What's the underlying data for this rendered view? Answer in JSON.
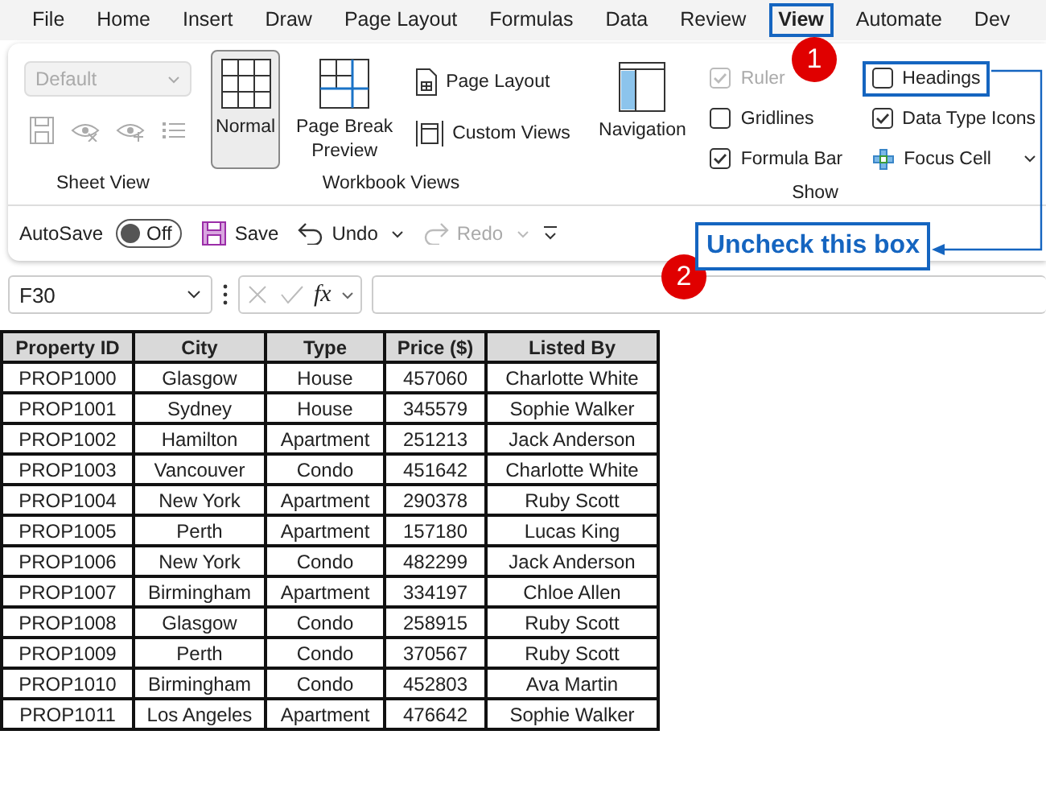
{
  "menu_tabs": [
    {
      "label": "File",
      "selected": false
    },
    {
      "label": "Home",
      "selected": false
    },
    {
      "label": "Insert",
      "selected": false
    },
    {
      "label": "Draw",
      "selected": false
    },
    {
      "label": "Page Layout",
      "selected": false
    },
    {
      "label": "Formulas",
      "selected": false
    },
    {
      "label": "Data",
      "selected": false
    },
    {
      "label": "Review",
      "selected": false
    },
    {
      "label": "View",
      "selected": true
    },
    {
      "label": "Automate",
      "selected": false
    },
    {
      "label": "Dev",
      "selected": false
    }
  ],
  "ribbon": {
    "sheet_view": {
      "label": "Sheet View",
      "dropdown": {
        "value": "Default",
        "disabled": true
      }
    },
    "workbook_views": {
      "label": "Workbook Views",
      "buttons": [
        {
          "kind": "large",
          "label": "Normal",
          "selected": true
        },
        {
          "kind": "large",
          "label": "Page Break Preview",
          "selected": false
        },
        {
          "kind": "small",
          "label": "Page Layout",
          "selected": false
        },
        {
          "kind": "small",
          "label": "Custom Views",
          "selected": false
        }
      ]
    },
    "show": {
      "label": "Show",
      "navigation": {
        "label": "Navigation"
      },
      "items": [
        {
          "kind": "checkbox",
          "label": "Ruler",
          "checked": true,
          "disabled": true,
          "highlighted": false
        },
        {
          "kind": "checkbox",
          "label": "Gridlines",
          "checked": false,
          "disabled": false,
          "highlighted": false
        },
        {
          "kind": "checkbox",
          "label": "Formula Bar",
          "checked": true,
          "disabled": false,
          "highlighted": false
        },
        {
          "kind": "checkbox",
          "label": "Headings",
          "checked": false,
          "disabled": false,
          "highlighted": true
        },
        {
          "kind": "checkbox",
          "label": "Data Type Icons",
          "checked": true,
          "disabled": false,
          "highlighted": false
        },
        {
          "kind": "button",
          "label": "Focus Cell"
        }
      ]
    }
  },
  "quick_access": {
    "autosave": {
      "label": "AutoSave",
      "on": false,
      "state_text": "Off"
    },
    "save": "Save",
    "undo": {
      "label": "Undo",
      "disabled": false
    },
    "redo": {
      "label": "Redo",
      "disabled": true
    }
  },
  "formula_bar": {
    "name_box": "F30",
    "fx": "fx"
  },
  "table": {
    "columns": [
      "Property ID",
      "City",
      "Type",
      "Price ($)",
      "Listed By"
    ],
    "rows": [
      [
        "PROP1000",
        "Glasgow",
        "House",
        "457060",
        "Charlotte White"
      ],
      [
        "PROP1001",
        "Sydney",
        "House",
        "345579",
        "Sophie Walker"
      ],
      [
        "PROP1002",
        "Hamilton",
        "Apartment",
        "251213",
        "Jack Anderson"
      ],
      [
        "PROP1003",
        "Vancouver",
        "Condo",
        "451642",
        "Charlotte White"
      ],
      [
        "PROP1004",
        "New York",
        "Apartment",
        "290378",
        "Ruby Scott"
      ],
      [
        "PROP1005",
        "Perth",
        "Apartment",
        "157180",
        "Lucas King"
      ],
      [
        "PROP1006",
        "New York",
        "Condo",
        "482299",
        "Jack Anderson"
      ],
      [
        "PROP1007",
        "Birmingham",
        "Apartment",
        "334197",
        "Chloe Allen"
      ],
      [
        "PROP1008",
        "Glasgow",
        "Condo",
        "258915",
        "Ruby Scott"
      ],
      [
        "PROP1009",
        "Perth",
        "Condo",
        "370567",
        "Ruby Scott"
      ],
      [
        "PROP1010",
        "Birmingham",
        "Condo",
        "452803",
        "Ava Martin"
      ],
      [
        "PROP1011",
        "Los Angeles",
        "Apartment",
        "476642",
        "Sophie Walker"
      ]
    ]
  },
  "annotations": {
    "badges": [
      "1",
      "2"
    ],
    "callout": "Uncheck this box"
  }
}
